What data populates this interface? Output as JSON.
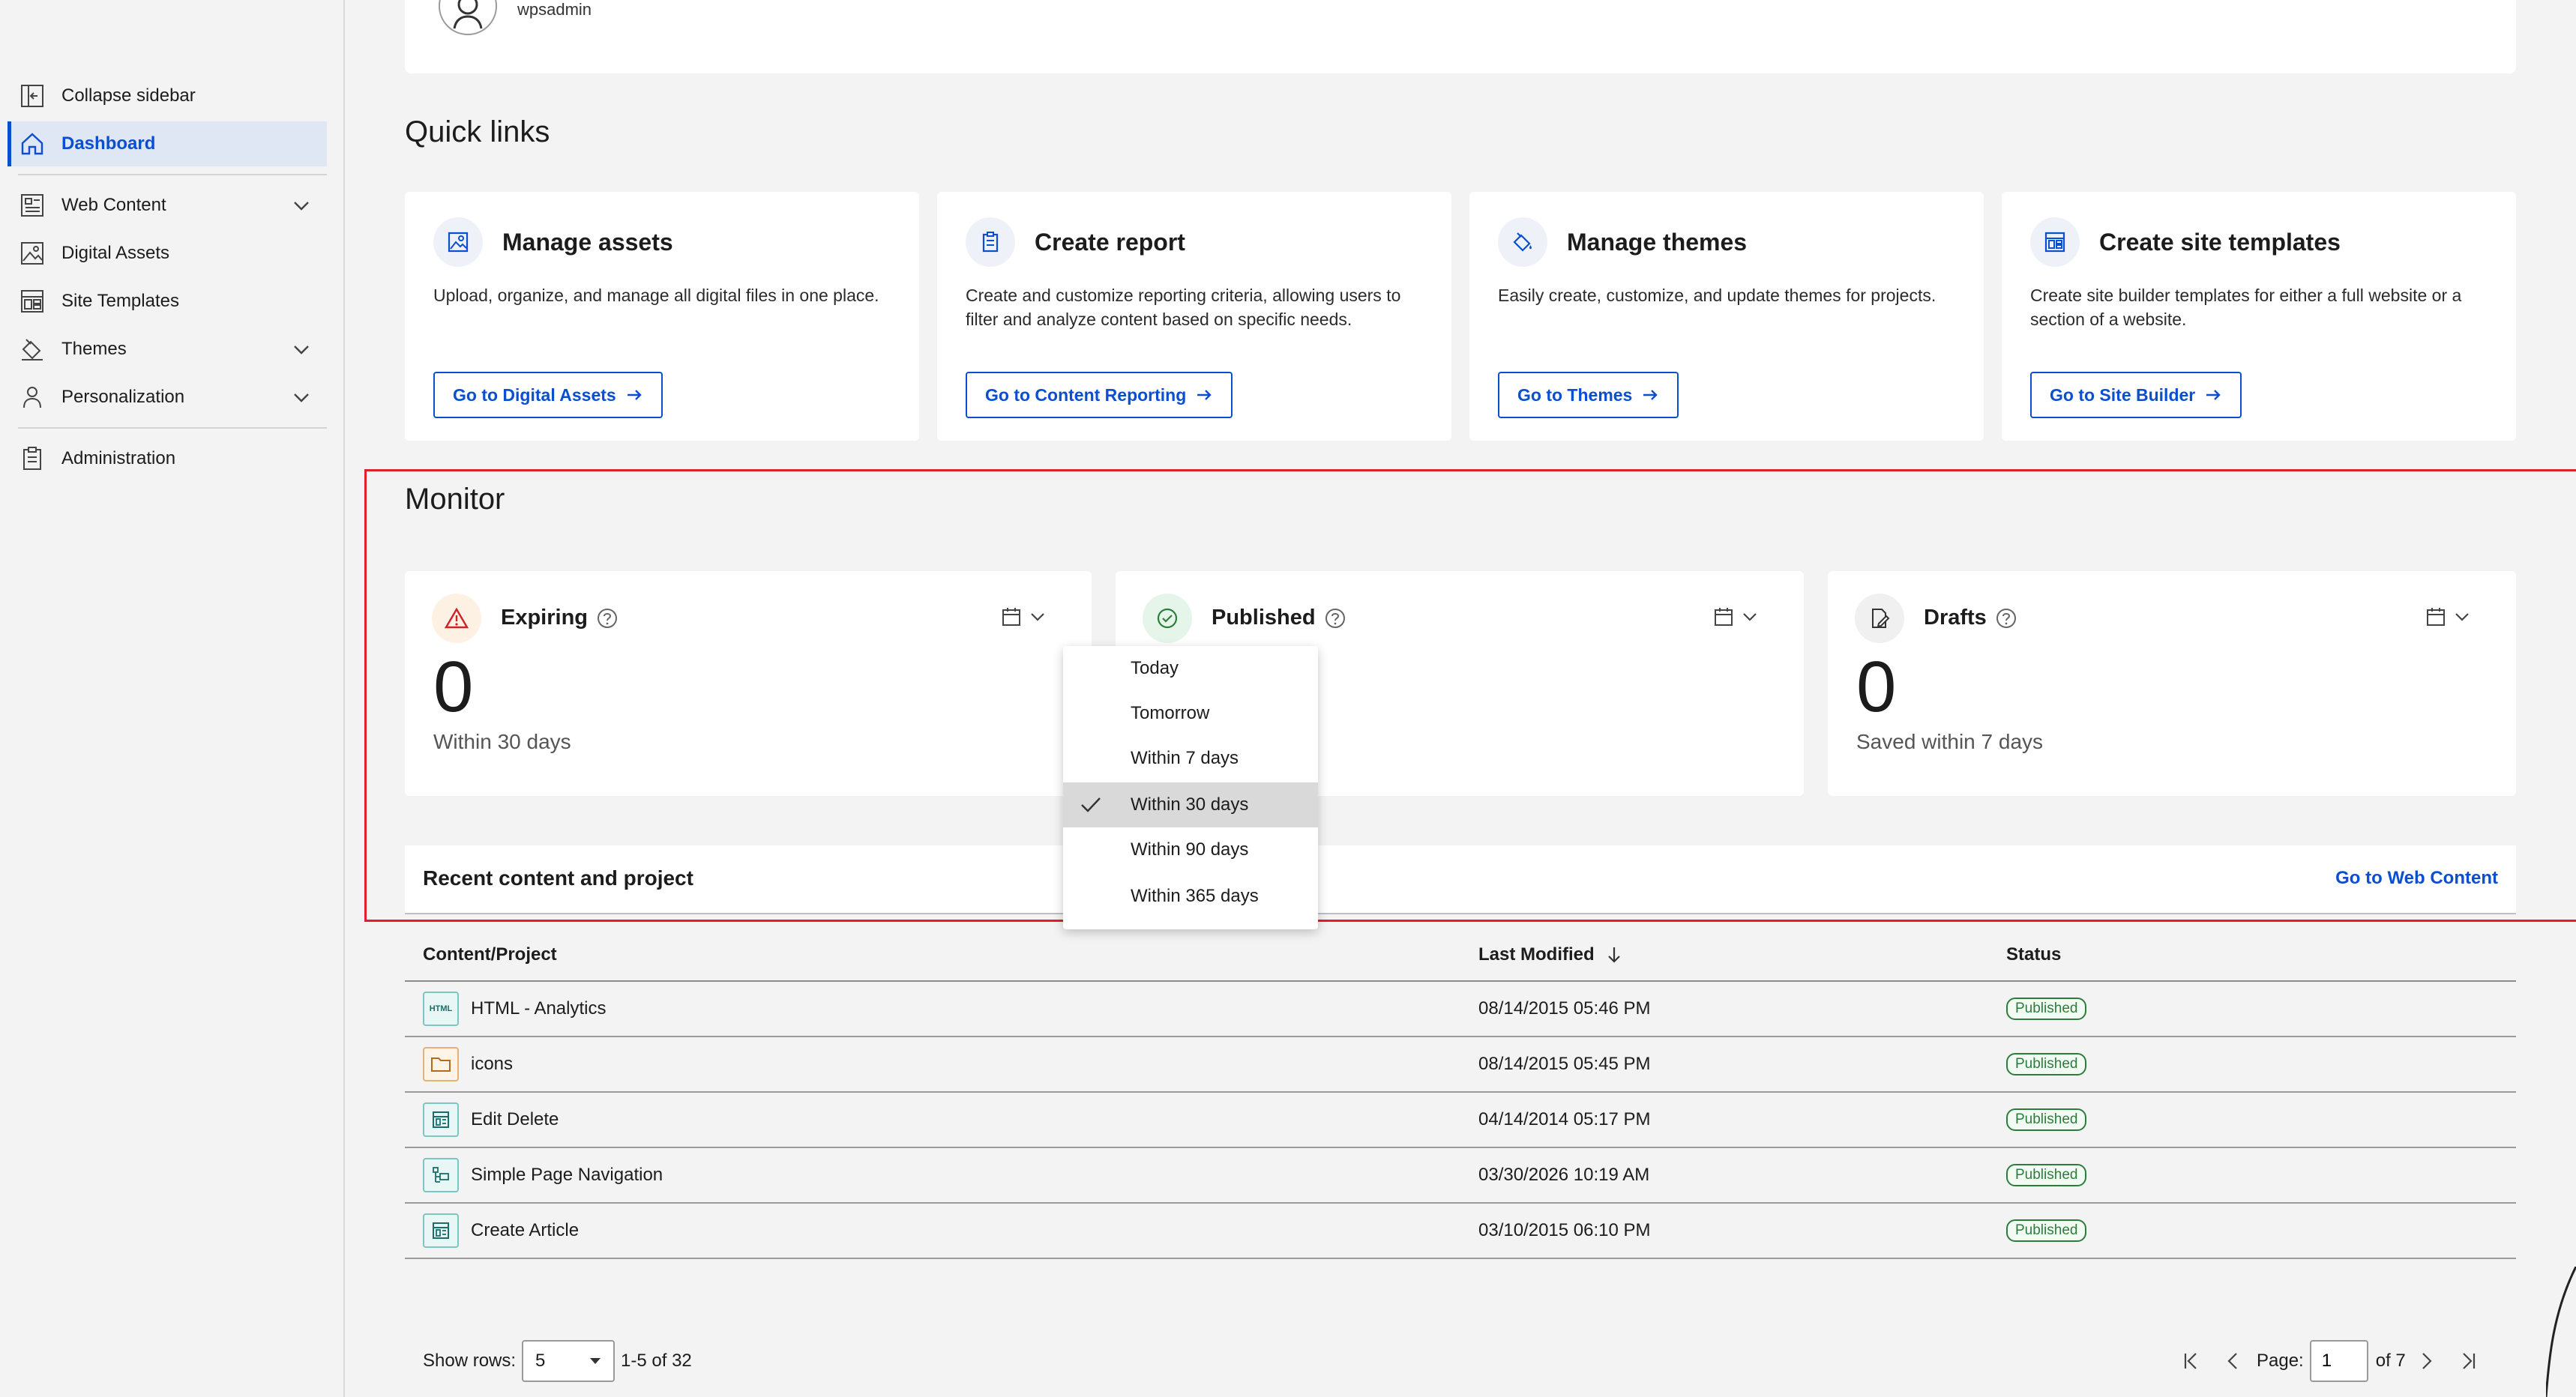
{
  "sidebar": {
    "items": [
      {
        "label": "Collapse sidebar"
      },
      {
        "label": "Dashboard"
      },
      {
        "label": "Web Content"
      },
      {
        "label": "Digital Assets"
      },
      {
        "label": "Site Templates"
      },
      {
        "label": "Themes"
      },
      {
        "label": "Personalization"
      },
      {
        "label": "Administration"
      }
    ]
  },
  "profile": {
    "username": "wpsadmin"
  },
  "quick_links": {
    "title": "Quick links",
    "cards": [
      {
        "title": "Manage assets",
        "description": "Upload, organize, and manage all digital files in one place.",
        "button": "Go to Digital Assets"
      },
      {
        "title": "Create report",
        "description": "Create and customize reporting criteria, allowing users to filter and analyze content based on specific needs.",
        "button": "Go to Content Reporting"
      },
      {
        "title": "Manage themes",
        "description": "Easily create, customize, and update themes for projects.",
        "button": "Go to Themes"
      },
      {
        "title": "Create site templates",
        "description": "Create site builder templates for either a full website or a section of a website.",
        "button": "Go to Site Builder"
      }
    ]
  },
  "monitor": {
    "title": "Monitor",
    "cards": [
      {
        "title": "Expiring",
        "value": "0",
        "subtitle": "Within 30 days"
      },
      {
        "title": "Published",
        "value": "",
        "subtitle": ""
      },
      {
        "title": "Drafts",
        "value": "0",
        "subtitle": "Saved within 7 days"
      }
    ],
    "range_options": [
      "Today",
      "Tomorrow",
      "Within 7 days",
      "Within 30 days",
      "Within 90 days",
      "Within 365 days"
    ],
    "selected_range": "Within 30 days"
  },
  "recent": {
    "title": "Recent content and project",
    "link": "Go to Web Content",
    "columns": [
      "Content/Project",
      "Last Modified",
      "Status"
    ],
    "rows": [
      {
        "name": "HTML - Analytics",
        "modified": "08/14/2015 05:46 PM",
        "status": "Published",
        "type_icon": "html-icon",
        "type_text": "HTML"
      },
      {
        "name": "icons",
        "modified": "08/14/2015 05:45 PM",
        "status": "Published",
        "type_icon": "folder-icon"
      },
      {
        "name": "Edit Delete",
        "modified": "04/14/2014 05:17 PM",
        "status": "Published",
        "type_icon": "layout-icon"
      },
      {
        "name": "Simple Page Navigation",
        "modified": "03/30/2026 10:19 AM",
        "status": "Published",
        "type_icon": "navigation-icon"
      },
      {
        "name": "Create Article",
        "modified": "03/10/2015 06:10 PM",
        "status": "Published",
        "type_icon": "layout-icon"
      }
    ]
  },
  "pagination": {
    "show_rows_label": "Show rows:",
    "rows_value": "5",
    "range_text": "1-5 of 32",
    "page_label": "Page:",
    "page_value": "1",
    "of_text": "of 7"
  },
  "colors": {
    "accent": "#0b4fd1",
    "highlight_border": "#e0202a",
    "status_green": "#2c7d3c"
  }
}
